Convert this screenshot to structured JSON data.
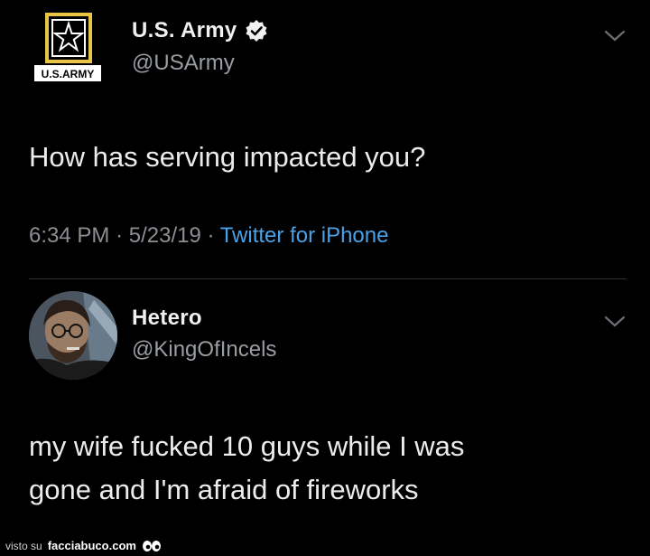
{
  "tweet": {
    "logo_text": "U.S.ARMY",
    "display_name": "U.S. Army",
    "handle": "@USArmy",
    "verified_icon": "verified-badge-icon",
    "text": "How has serving impacted you?",
    "time": "6:34 PM",
    "date": "5/23/19",
    "separator": "·",
    "client": "Twitter for iPhone"
  },
  "reply": {
    "display_name": "Hetero",
    "handle": "@KingOfIncels",
    "text_line1": "my wife fucked 10 guys while I was",
    "text_line2": "gone and I'm afraid of fireworks"
  },
  "footer": {
    "prefix": "visto su",
    "brand": "facciabuco.com"
  },
  "colors": {
    "background": "#000000",
    "link": "#4aa1e8",
    "secondary_text": "#8b8f94",
    "army_gold": "#e8c547"
  }
}
